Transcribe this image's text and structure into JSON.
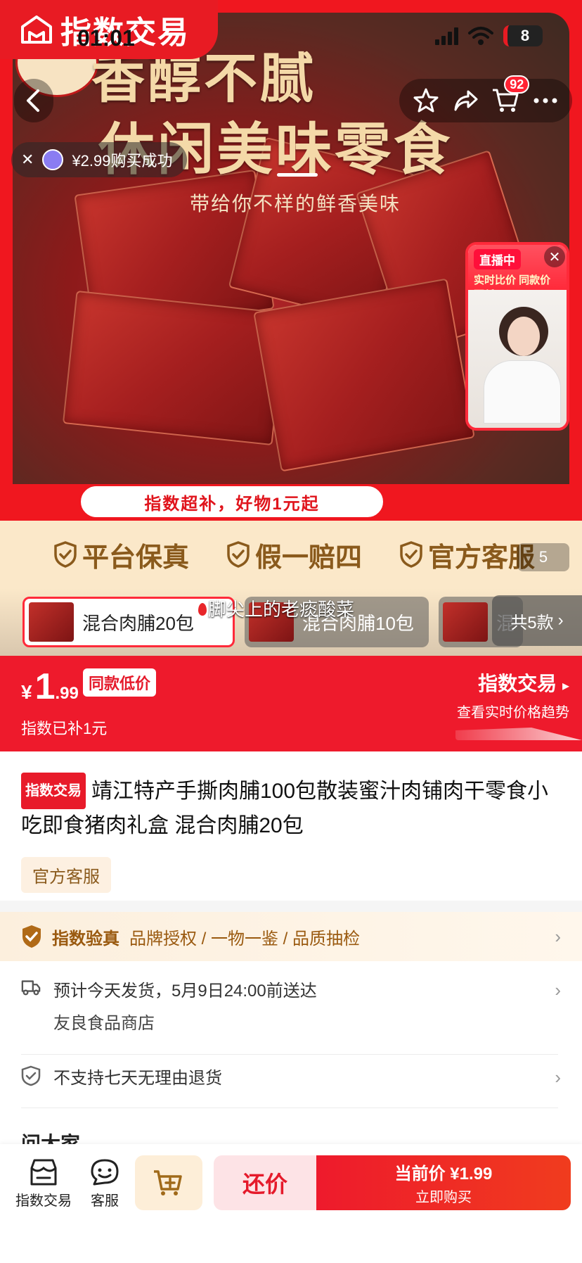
{
  "status_bar": {
    "time": "01:01",
    "battery": "8"
  },
  "brand": {
    "name": "指数交易"
  },
  "nav": {
    "cart_count": "92"
  },
  "toast": {
    "text": "¥2.99购买成功"
  },
  "hero": {
    "headline": "香醇不腻",
    "headline2": "休闲美味零食",
    "subline": "带给你不样的鲜香美味",
    "promo": "指数超补，好物1元起",
    "image_index": "5"
  },
  "live": {
    "tag": "直播中",
    "caption": "实时比价 同款价更低"
  },
  "guarantees": [
    {
      "label": "平台保真"
    },
    {
      "label": "假一赔四"
    },
    {
      "label": "官方客服"
    }
  ],
  "variants": {
    "items": [
      {
        "label": "混合肉脯20包",
        "selected": true
      },
      {
        "label": "混合肉脯10包",
        "selected": false
      },
      {
        "label": "混",
        "selected": false
      }
    ],
    "more_label": "共5款",
    "danmaku": "脚尖上的老痰酸菜"
  },
  "price": {
    "currency": "¥",
    "integer": "1",
    "decimal": ".99",
    "low_tag": "同款低价",
    "subsidy": "指数已补1元",
    "index_title": "指数交易",
    "index_sub": "查看实时价格趋势"
  },
  "product": {
    "tag": "指数交易",
    "title": "靖江特产手撕肉脯100包散装蜜汁肉铺肉干零食小吃即食猪肉礼盒 混合肉脯20包",
    "service_tag": "官方客服"
  },
  "verify": {
    "title": "指数验真",
    "items": "品牌授权 / 一物一鉴 / 品质抽检"
  },
  "shipping": {
    "line1": "预计今天发货，5月9日24:00前送达",
    "line2": "友良食品商店"
  },
  "returns": {
    "text": "不支持七天无理由退货"
  },
  "ask": {
    "title": "问大家"
  },
  "bottom_bar": {
    "index_label": "指数交易",
    "service_label": "客服",
    "bargain_label": "还价",
    "buy_price_label": "当前价 ¥1.99",
    "buy_label": "立即购买"
  },
  "colors": {
    "brand_red": "#ee1a2c",
    "gold": "#8a5a1c",
    "cream": "#fbe8c9"
  }
}
